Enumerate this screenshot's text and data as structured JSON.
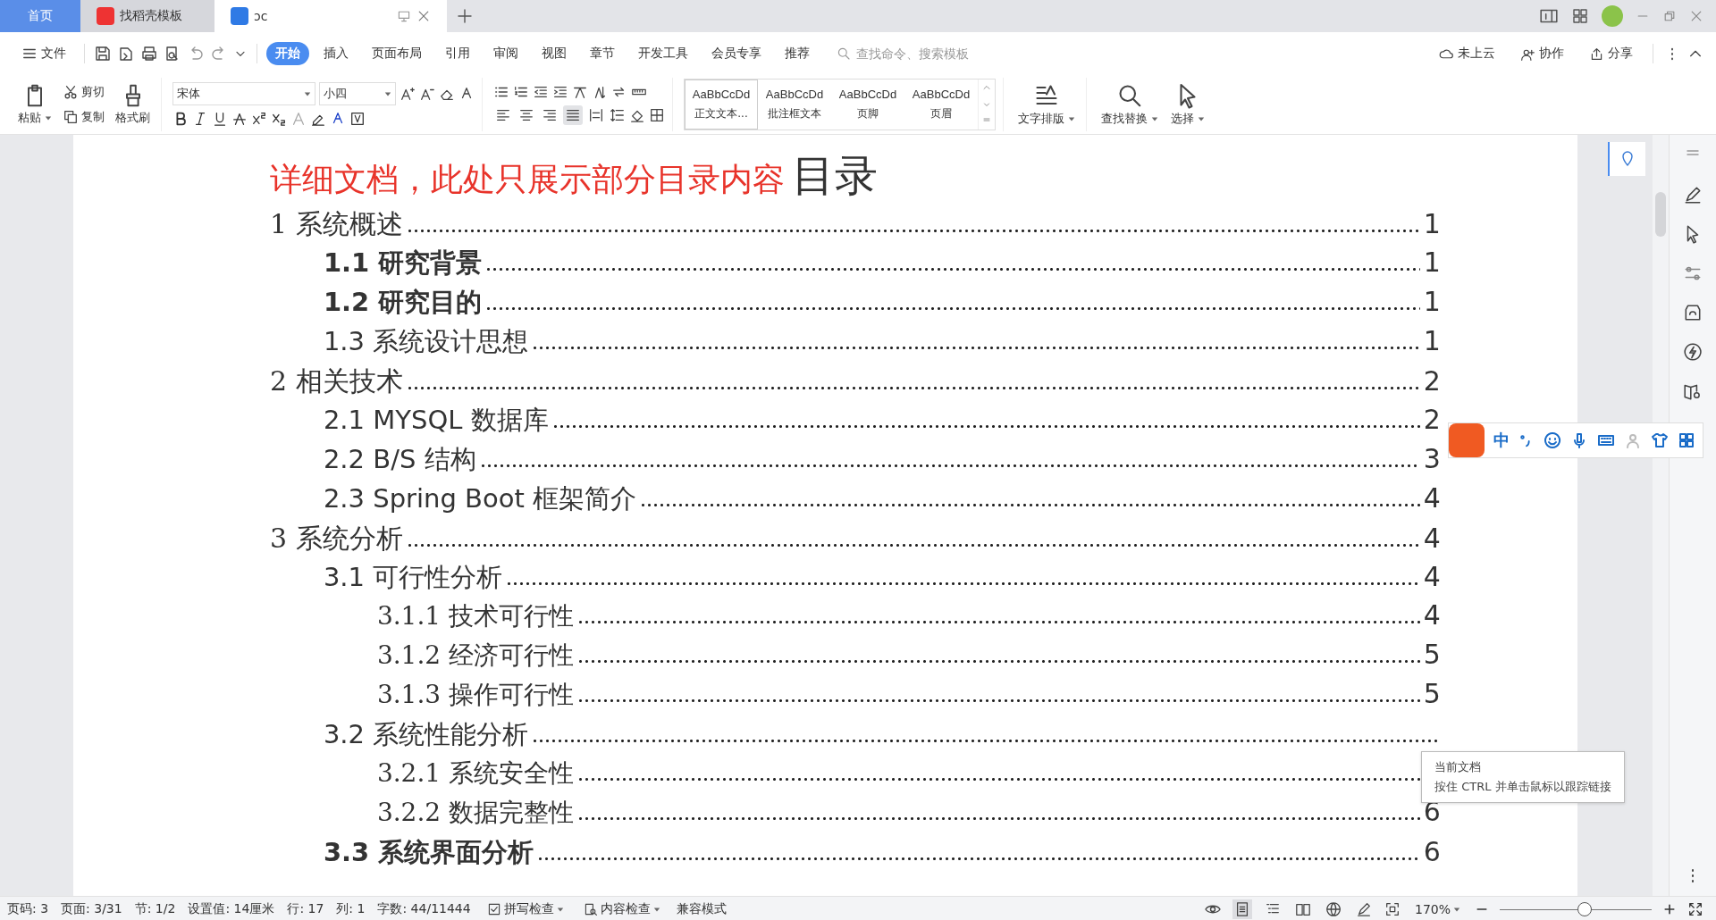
{
  "tabs": [
    {
      "label": "首页",
      "kind": "home",
      "selected": false
    },
    {
      "label": "找稻壳模板",
      "kind": "template",
      "selected": false
    },
    {
      "label": "ɔc",
      "kind": "doc",
      "selected": true
    }
  ],
  "menu": {
    "file": "文件",
    "tabs": [
      {
        "label": "开始",
        "selected": true
      },
      {
        "label": "插入",
        "selected": false
      },
      {
        "label": "页面布局",
        "selected": false
      },
      {
        "label": "引用",
        "selected": false
      },
      {
        "label": "审阅",
        "selected": false
      },
      {
        "label": "视图",
        "selected": false
      },
      {
        "label": "章节",
        "selected": false
      },
      {
        "label": "开发工具",
        "selected": false
      },
      {
        "label": "会员专享",
        "selected": false
      },
      {
        "label": "推荐",
        "selected": false
      }
    ],
    "search": {
      "placeholder": "查找命令、搜索模板"
    },
    "actions": [
      {
        "label": "未上云",
        "kind": "cloud"
      },
      {
        "label": "协作",
        "kind": "collab"
      },
      {
        "label": "分享",
        "kind": "share"
      }
    ]
  },
  "ribbon": {
    "paste": "粘贴",
    "cut": "剪切",
    "copy": "复制",
    "format_painter": "格式刷",
    "font": "宋体",
    "size": "小四",
    "align_buttons": [
      {
        "kind": "left",
        "selected": false
      },
      {
        "kind": "center",
        "selected": false
      },
      {
        "kind": "right",
        "selected": false
      },
      {
        "kind": "justify",
        "selected": true
      },
      {
        "kind": "distributed",
        "selected": false
      }
    ],
    "styles": [
      {
        "sample": "AaBbCcDd",
        "name": "正文文本...",
        "selected": true
      },
      {
        "sample": "AaBbCcDd",
        "name": "批注框文本",
        "selected": false
      },
      {
        "sample": "AaBbCcDd",
        "name": "页脚",
        "selected": false
      },
      {
        "sample": "AaBbCcDd",
        "name": "页眉",
        "selected": false
      }
    ],
    "text_layout": "文字排版",
    "find_replace": "查找替换",
    "select": "选择"
  },
  "document": {
    "note": "详细文档，此处只展示部分目录内容",
    "heading": "目录",
    "toc": [
      {
        "title": "1 系统概述",
        "page": "1",
        "bold": false,
        "children": [
          {
            "title": "1.1  研究背景",
            "page": "1",
            "bold": true
          },
          {
            "title": "1.2 研究目的",
            "page": "1",
            "bold": true
          },
          {
            "title": "1.3 系统设计思想",
            "page": "1",
            "bold": false
          }
        ]
      },
      {
        "title": "2 相关技术",
        "page": "2",
        "bold": false,
        "children": [
          {
            "title": "2.1 MYSQL 数据库",
            "page": "2",
            "bold": false
          },
          {
            "title": "2.2 B/S 结构",
            "page": "3",
            "bold": false
          },
          {
            "title": "2.3 Spring Boot 框架简介",
            "page": "4",
            "bold": false
          }
        ]
      },
      {
        "title": "3 系统分析",
        "page": "4",
        "bold": false,
        "children": [
          {
            "title": "3.1 可行性分析",
            "page": "4",
            "bold": false,
            "children": [
              {
                "title": "3.1.1 技术可行性",
                "page": "4",
                "bold": false
              },
              {
                "title": "3.1.2 经济可行性",
                "page": "5",
                "bold": false
              },
              {
                "title": "3.1.3 操作可行性",
                "page": "5",
                "bold": false
              }
            ]
          },
          {
            "title": "3.2 系统性能分析",
            "bold": false,
            "children": [
              {
                "title": "3.2.1  系统安全性",
                "bold": false
              },
              {
                "title": "3.2.2  数据完整性",
                "page": "6",
                "bold": false
              }
            ]
          },
          {
            "title": "3.3 系统界面分析",
            "page": "6",
            "bold": true
          }
        ]
      }
    ]
  },
  "ime": {
    "label": "中"
  },
  "tooltip": {
    "title": "当前文档",
    "text": "按住 CTRL 并单击鼠标以跟踪链接"
  },
  "status_bar": {
    "items": [
      "页码: 3",
      "页面: 3/31",
      "节: 1/2",
      "设置值: 14厘米",
      "行: 17",
      "列: 1",
      "字数: 44/11444"
    ],
    "spell_check": "拼写检查",
    "content_check": "内容检查",
    "mode": "兼容模式",
    "view_modes": [
      {
        "kind": "page",
        "selected": true
      },
      {
        "kind": "outline",
        "selected": false
      },
      {
        "kind": "read",
        "selected": false
      },
      {
        "kind": "web",
        "selected": false
      },
      {
        "kind": "write",
        "selected": false
      }
    ],
    "zoom": "170%",
    "zoom_slider": {
      "level": 0.55
    }
  }
}
